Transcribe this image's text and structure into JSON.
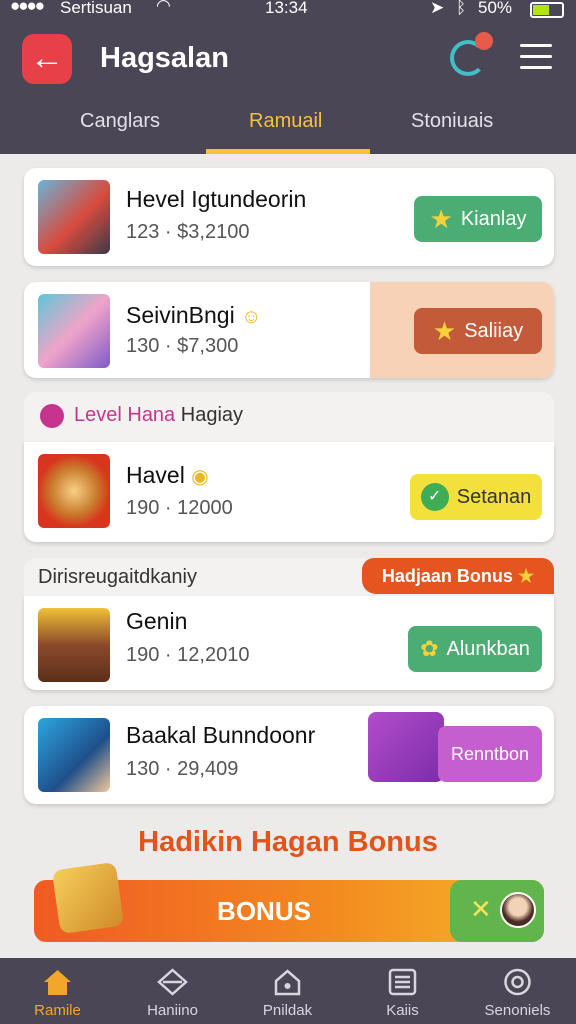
{
  "status_bar": {
    "carrier": "Sertisuan",
    "time": "13:34",
    "battery": "50%"
  },
  "header": {
    "title": "Hagsalan"
  },
  "tabs": [
    {
      "label": "Canglars"
    },
    {
      "label": "Ramuail"
    },
    {
      "label": "Stoniuais"
    }
  ],
  "items": [
    {
      "title": "Hevel Igtundeorin",
      "meta": "123 · $3,2100",
      "action": "Kianlay"
    },
    {
      "title": "SeivinBngi",
      "meta": "130 · $7,300",
      "action": "Saliiay"
    },
    {
      "title": "Havel",
      "meta": "190 · 12000",
      "action": "Setanan"
    },
    {
      "title": "Genin",
      "meta": "190 · 12,2010",
      "action": "Alunkban"
    },
    {
      "title": "Baakal Bunndoonr",
      "meta": "130 · 29,409",
      "action": "Renntbon"
    }
  ],
  "sections": {
    "level": "Level Hana Hagiay",
    "level_highlight": "Level Hana",
    "level_rest": "Hagiay",
    "discover": "Dirisreugaitdkaniy",
    "discover_badge": "Hadjaan Bonus"
  },
  "bonus": {
    "heading": "Hadikin Hagan Bonus",
    "button_label": "BONUS"
  },
  "nav": [
    {
      "label": "Ramile"
    },
    {
      "label": "Haniino"
    },
    {
      "label": "Pnildak"
    },
    {
      "label": "Kaiis"
    },
    {
      "label": "Senoniels"
    }
  ],
  "colors": {
    "header_bg": "#4a4655",
    "accent_yellow": "#f4c23d",
    "green_button": "#4cad74",
    "orange_bonus": "#f05a22",
    "purple": "#a24cc0"
  }
}
